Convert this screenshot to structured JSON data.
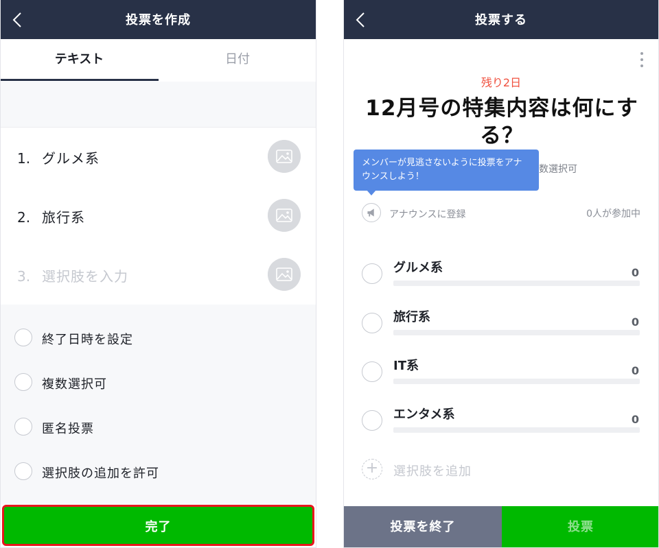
{
  "left_screen": {
    "title": "投票を作成",
    "tabs": [
      {
        "label": "テキスト"
      },
      {
        "label": "日付"
      }
    ],
    "options": [
      {
        "number": "1.",
        "text": "グルメ系"
      },
      {
        "number": "2.",
        "text": "旅行系"
      },
      {
        "number": "3.",
        "placeholder": "選択肢を入力"
      }
    ],
    "settings": [
      {
        "label": "終了日時を設定"
      },
      {
        "label": "複数選択可"
      },
      {
        "label": "匿名投票"
      },
      {
        "label": "選択肢の追加を許可"
      }
    ],
    "done_label": "完了"
  },
  "right_screen": {
    "title": "投票する",
    "remaining": "残り2日",
    "question": "12月号の特集内容は何にする？",
    "multi_select_fragment": "数選択可",
    "tooltip": "メンバーが見逃さないように投票をアナウンスしよう！",
    "announce_label": "アナウンスに登録",
    "participants": "0人が参加中",
    "choices": [
      {
        "label": "グルメ系",
        "count": "0",
        "share": 0
      },
      {
        "label": "旅行系",
        "count": "0",
        "share": 0
      },
      {
        "label": "IT系",
        "count": "0",
        "share": 0
      },
      {
        "label": "エンタメ系",
        "count": "0",
        "share": 0
      }
    ],
    "add_choice_label": "選択肢を追加",
    "end_label": "投票を終了",
    "vote_label": "投票"
  },
  "colors": {
    "header_bg": "#283147",
    "line_green": "#00b900",
    "remaining_red": "#f0503e",
    "tooltip_blue": "#5689e4",
    "highlight_red": "#e8161d",
    "end_button_gray": "#6c7388"
  },
  "icons": {
    "back": "chevron-left-icon",
    "image": "image-icon",
    "more": "more-vertical-icon",
    "megaphone": "megaphone-icon",
    "add": "plus-icon"
  }
}
